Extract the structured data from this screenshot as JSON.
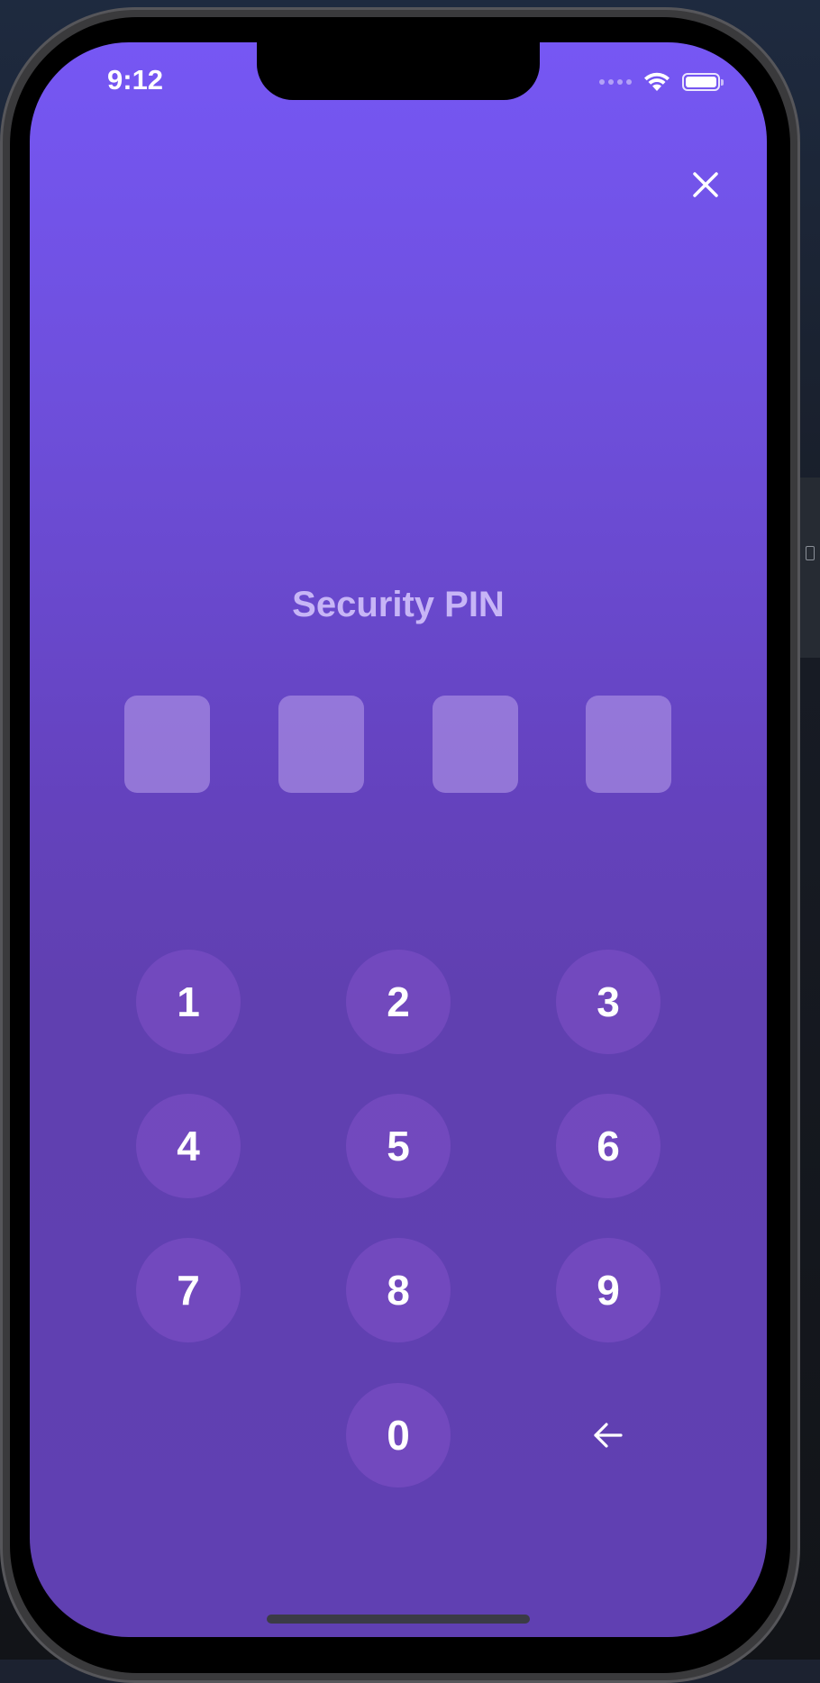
{
  "status_bar": {
    "time": "9:12"
  },
  "close_icon": "close-icon",
  "title": "Security PIN",
  "pin": {
    "length": 4,
    "entered": 0
  },
  "keypad": {
    "keys": [
      "1",
      "2",
      "3",
      "4",
      "5",
      "6",
      "7",
      "8",
      "9",
      "0"
    ],
    "backspace_icon": "backspace-arrow-icon"
  },
  "colors": {
    "background_top": "#7657f4",
    "background_bottom": "#6040b2",
    "key_fill": "#7048b8",
    "pin_box_fill": "#9279cc",
    "text": "#ffffff"
  }
}
